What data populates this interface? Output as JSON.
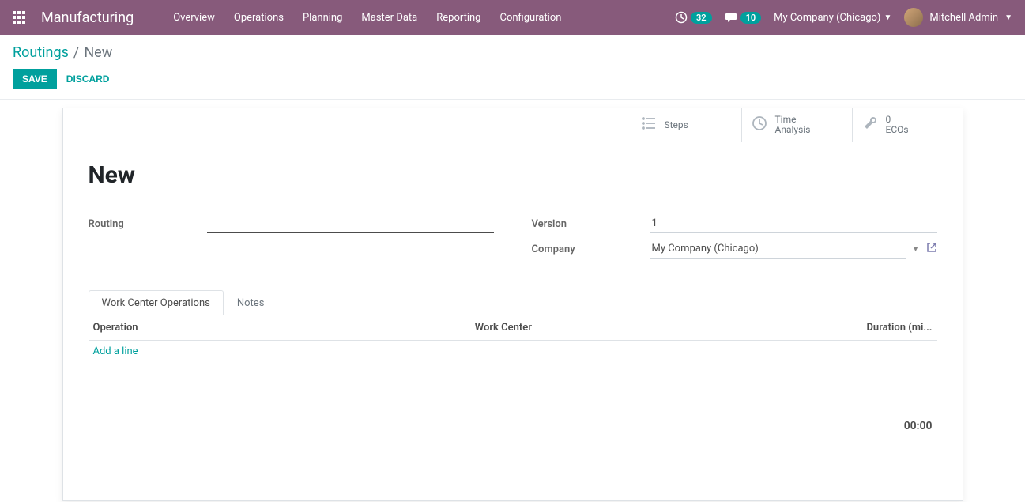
{
  "navbar": {
    "app_name": "Manufacturing",
    "menu": [
      "Overview",
      "Operations",
      "Planning",
      "Master Data",
      "Reporting",
      "Configuration"
    ],
    "activity_count": "32",
    "message_count": "10",
    "company": "My Company (Chicago)",
    "user": "Mitchell Admin"
  },
  "breadcrumb": {
    "parent": "Routings",
    "current": "New"
  },
  "buttons": {
    "save": "Save",
    "discard": "Discard"
  },
  "stat_buttons": {
    "steps": "Steps",
    "time_analysis_line1": "Time",
    "time_analysis_line2": "Analysis",
    "ecos_count": "0",
    "ecos_label": "ECOs"
  },
  "form": {
    "title": "New",
    "routing_label": "Routing",
    "routing_value": "",
    "version_label": "Version",
    "version_value": "1",
    "company_label": "Company",
    "company_value": "My Company (Chicago)"
  },
  "tabs": {
    "work_center_operations": "Work Center Operations",
    "notes": "Notes"
  },
  "table": {
    "col_operation": "Operation",
    "col_work_center": "Work Center",
    "col_duration": "Duration (mi...",
    "add_line": "Add a line",
    "total_duration": "00:00"
  }
}
